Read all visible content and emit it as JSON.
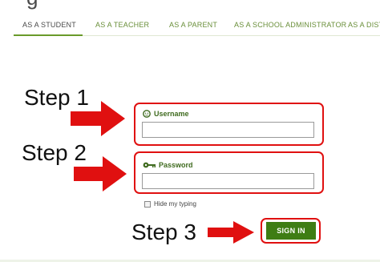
{
  "header": {
    "heading_partial": "g"
  },
  "tabs": [
    {
      "label": "AS A STUDENT",
      "active": true
    },
    {
      "label": "AS A TEACHER",
      "active": false
    },
    {
      "label": "AS A PARENT",
      "active": false
    },
    {
      "label": "AS A SCHOOL ADMINISTRATOR",
      "active": false
    },
    {
      "label": "AS A DIST",
      "active": false
    }
  ],
  "steps": {
    "step1": "Step 1",
    "step2": "Step 2",
    "step3": "Step 3"
  },
  "form": {
    "username_label": "Username",
    "username_value": "",
    "password_label": "Password",
    "password_value": "",
    "hide_typing_label": "Hide my typing",
    "hide_typing_checked": false,
    "signin_label": "SIGN IN"
  },
  "colors": {
    "accent_green": "#3e7d14",
    "tab_green": "#6a8f3a",
    "annotation_red": "#e01010"
  },
  "icons": {
    "username": "face-icon",
    "password": "key-icon"
  }
}
